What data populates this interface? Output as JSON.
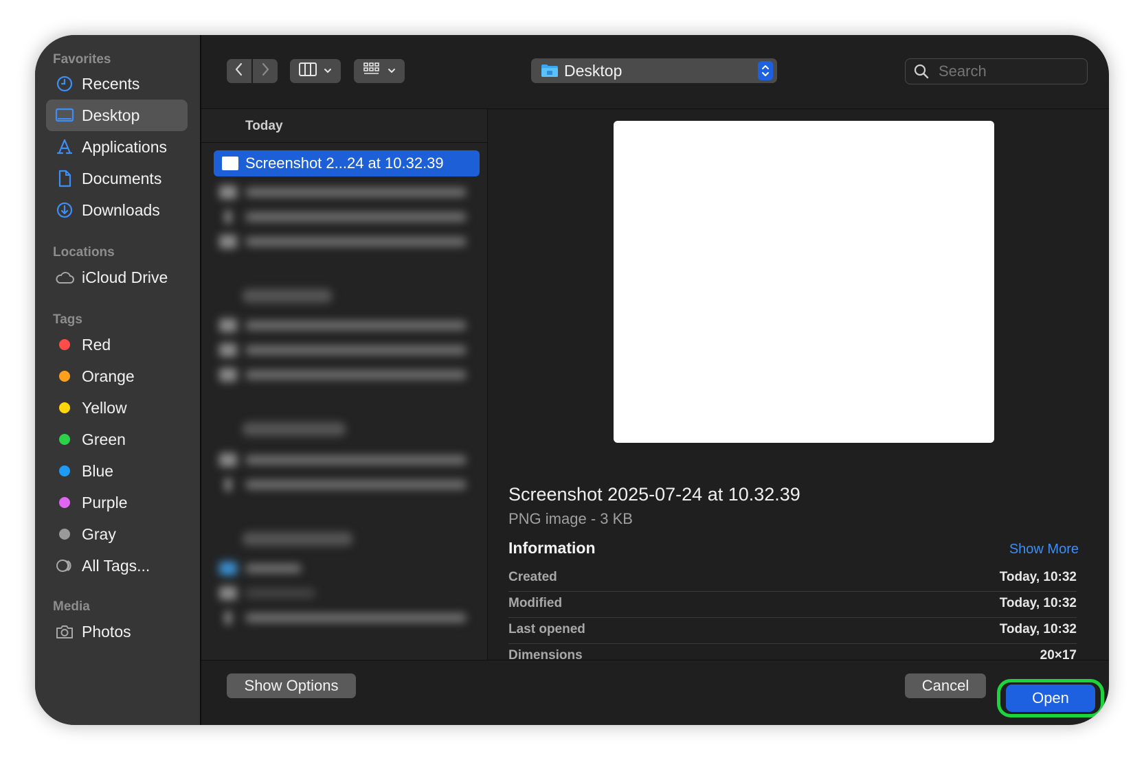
{
  "sidebar": {
    "favorites_title": "Favorites",
    "favorites": [
      {
        "label": "Recents",
        "icon": "clock-icon"
      },
      {
        "label": "Desktop",
        "icon": "desktop-icon"
      },
      {
        "label": "Applications",
        "icon": "applications-icon"
      },
      {
        "label": "Documents",
        "icon": "document-icon"
      },
      {
        "label": "Downloads",
        "icon": "download-icon"
      }
    ],
    "locations_title": "Locations",
    "locations": [
      {
        "label": "iCloud Drive",
        "icon": "cloud-icon"
      }
    ],
    "tags_title": "Tags",
    "tags": [
      {
        "label": "Red",
        "color": "#ff4d4a"
      },
      {
        "label": "Orange",
        "color": "#ffa01c"
      },
      {
        "label": "Yellow",
        "color": "#ffd60a"
      },
      {
        "label": "Green",
        "color": "#2bd24a"
      },
      {
        "label": "Blue",
        "color": "#1d9bf5"
      },
      {
        "label": "Purple",
        "color": "#e065f0"
      },
      {
        "label": "Gray",
        "color": "#9a9a9a"
      },
      {
        "label": "All Tags...",
        "icon": "all-tags-icon"
      }
    ],
    "media_title": "Media",
    "media": [
      {
        "label": "Photos",
        "icon": "camera-icon"
      }
    ]
  },
  "toolbar": {
    "location": "Desktop",
    "search_placeholder": "Search"
  },
  "list": {
    "group_today": "Today",
    "selected_file": "Screenshot 2...24 at 10.32.39"
  },
  "preview": {
    "file_name": "Screenshot 2025-07-24 at 10.32.39",
    "file_kind": "PNG image - 3 KB",
    "info_title": "Information",
    "show_more": "Show More",
    "meta": [
      {
        "key": "Created",
        "value": "Today, 10:32"
      },
      {
        "key": "Modified",
        "value": "Today, 10:32"
      },
      {
        "key": "Last opened",
        "value": "Today, 10:32"
      },
      {
        "key": "Dimensions",
        "value": "20×17"
      }
    ]
  },
  "buttons": {
    "show_options": "Show Options",
    "cancel": "Cancel",
    "open": "Open"
  },
  "colors": {
    "accent": "#1d60e0",
    "highlight_ring": "#1ed43d",
    "sidebar_icon": "#3d8ef7"
  }
}
